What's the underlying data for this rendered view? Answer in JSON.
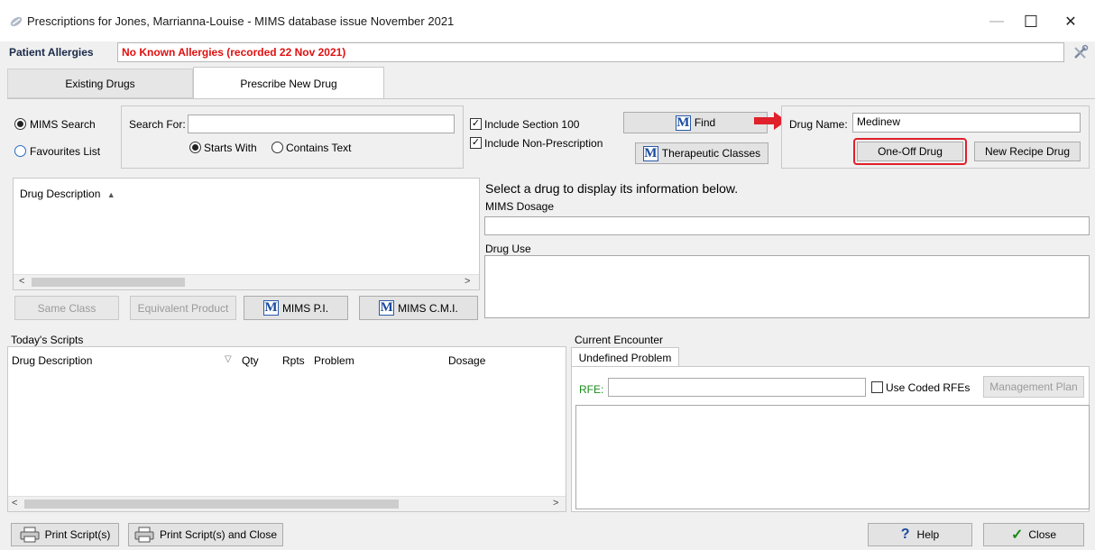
{
  "window": {
    "title": "Prescriptions for Jones, Marrianna-Louise  - MIMS database issue November 2021",
    "minimize": "—",
    "maximize": "☐",
    "close": "✕"
  },
  "allergies": {
    "label": "Patient Allergies",
    "value": "No Known Allergies (recorded 22 Nov 2021)"
  },
  "tabs": [
    {
      "label": "Existing Drugs"
    },
    {
      "label": "Prescribe New Drug"
    }
  ],
  "search": {
    "mims_search": "MIMS Search",
    "favourites_list": "Favourites List",
    "search_for_label": "Search For:",
    "search_value": "",
    "starts_with": "Starts With",
    "contains_text": "Contains Text",
    "include_section_100": "Include Section 100",
    "include_non_prescription": "Include Non-Prescription",
    "find_btn": "Find",
    "therapeutic_btn": "Therapeutic Classes"
  },
  "drug_name": {
    "label": "Drug Name:",
    "value": "Medinew",
    "one_off": "One-Off Drug",
    "new_recipe": "New Recipe Drug"
  },
  "drug_list": {
    "header": "Drug Description",
    "sort_indicator": "▲"
  },
  "info": {
    "prompt": "Select a drug to display its information below.",
    "mims_dosage": "MIMS Dosage",
    "drug_use": "Drug Use"
  },
  "drug_buttons": {
    "same_class": "Same Class",
    "equivalent": "Equivalent Product",
    "mims_pi": "MIMS P.I.",
    "mims_cmi": "MIMS C.M.I."
  },
  "todays_scripts": {
    "title": "Today's Scripts",
    "columns": [
      "Drug Description",
      "Qty",
      "Rpts",
      "Problem",
      "Dosage"
    ]
  },
  "encounter": {
    "title": "Current Encounter",
    "tab": "Undefined Problem",
    "rfe_label": "RFE:",
    "rfe_value": "",
    "use_coded": "Use Coded RFEs",
    "management_plan": "Management Plan"
  },
  "footer": {
    "print_scripts": "Print Script(s)",
    "print_close": "Print Script(s) and Close",
    "help": "Help",
    "close": "Close"
  },
  "colors": {
    "allergy_text": "#e01010",
    "highlight": "#e0202a",
    "mims_blue": "#1a4aa0"
  }
}
